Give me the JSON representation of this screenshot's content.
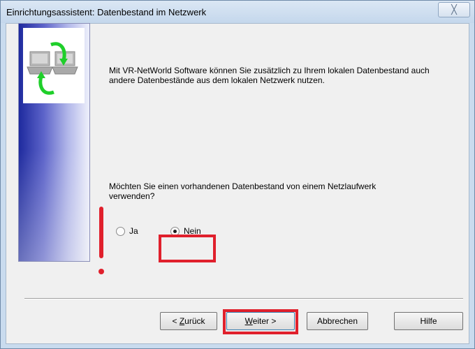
{
  "window": {
    "title": "Einrichtungsassistent: Datenbestand im Netzwerk",
    "close_glyph": "╳"
  },
  "content": {
    "intro_text": "Mit VR-NetWorld Software können Sie zusätzlich zu Ihrem lokalen Datenbestand auch andere Datenbestände aus dem lokalen Netzwerk nutzen.",
    "question_text": "Möchten Sie einen vorhandenen Datenbestand von einem Netzlaufwerk verwenden?",
    "options": [
      {
        "label": "Ja",
        "selected": false
      },
      {
        "label": "Nein",
        "selected": true
      }
    ]
  },
  "buttons": {
    "back": {
      "prefix": "< ",
      "underlined": "Z",
      "rest": "urück"
    },
    "next": {
      "underlined": "W",
      "rest": "eiter >"
    },
    "cancel": "Abbrechen",
    "help": "Hilfe"
  },
  "colors": {
    "highlight": "#e0202c",
    "panel_gradient_start": "#1e2a9e",
    "panel_gradient_end": "#eef0fb"
  },
  "icons": {
    "wizard_logo": "network-computers-sync-icon"
  }
}
